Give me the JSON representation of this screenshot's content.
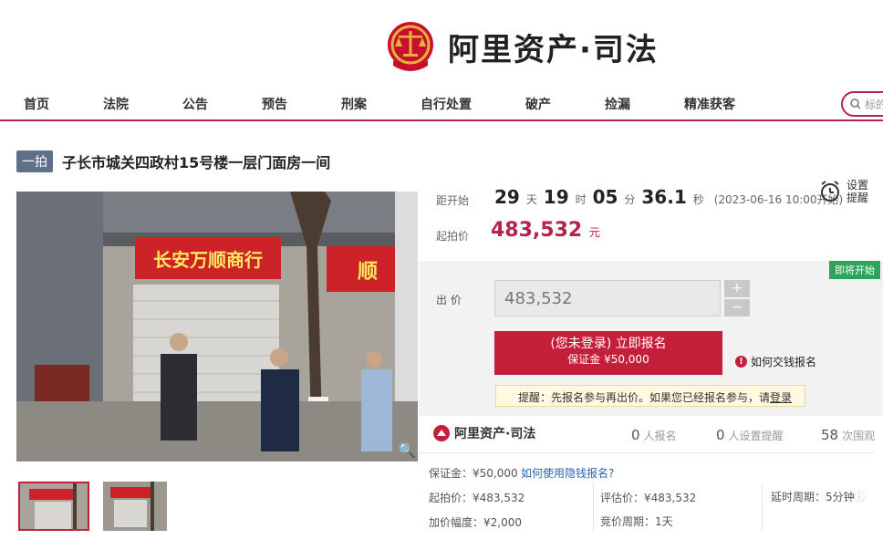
{
  "brand": {
    "name": "阿里资产·司法",
    "short": "阿里资产·司法"
  },
  "nav": {
    "items": [
      "首页",
      "法院",
      "公告",
      "预告",
      "刑案",
      "自行处置",
      "破产",
      "捡漏",
      "精准获客"
    ]
  },
  "search": {
    "placeholder": "标的"
  },
  "item": {
    "badge": "一拍",
    "title": "子长市城关四政村15号楼一层门面房一间"
  },
  "photo": {
    "shop_sign": "长安万顺商行",
    "side_sign": "顺"
  },
  "countdown": {
    "label": "距开始",
    "days": "29",
    "days_unit": "天",
    "hours": "19",
    "hours_unit": "时",
    "minutes": "05",
    "minutes_unit": "分",
    "seconds": "36.1",
    "seconds_unit": "秒",
    "start": "(2023-06-16 10:00开始)"
  },
  "remind": {
    "label": "设置提醒"
  },
  "price": {
    "label": "起拍价",
    "value": "483,532",
    "unit": "元"
  },
  "status_tag": "即将开始",
  "bid": {
    "label": "出 价",
    "value": "483,532",
    "plus": "+",
    "minus": "−"
  },
  "apply": {
    "label": "(您未登录) 立即报名",
    "deposit": "保证金 ¥50,000"
  },
  "howto": {
    "label": "如何交钱报名"
  },
  "tip": {
    "text": "提醒：先报名参与再出价。如果您已经报名参与，请",
    "link": "登录"
  },
  "stats": {
    "applicants": "0",
    "applicants_label": "人报名",
    "reminders": "0",
    "reminders_label": "人设置提醒",
    "views": "58",
    "views_label": "次围观"
  },
  "details": {
    "deposit": "保证金：¥50,000",
    "deposit_link": "如何使用隐钱报名?",
    "start_price": "起拍价：¥483,532",
    "assessed": "评估价：¥483,532",
    "delay": "延时周期：5分钟",
    "increment": "加价幅度：¥2,000",
    "bid_cycle": "竞价周期：1天"
  },
  "colors": {
    "accent": "#b3234a",
    "button": "#c41f3a",
    "tag": "#2fa35b",
    "badge": "#5e6f8a"
  }
}
